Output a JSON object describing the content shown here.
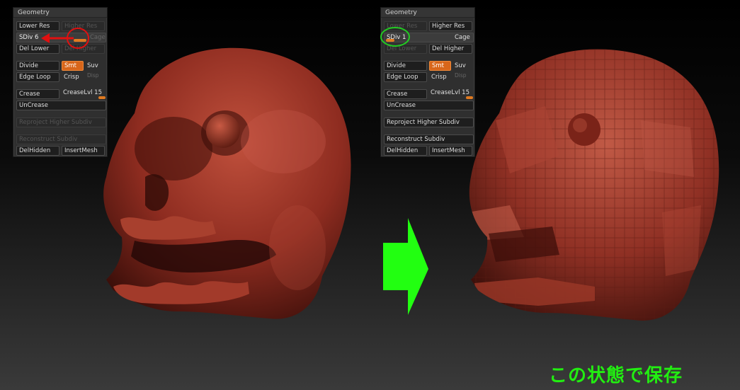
{
  "panels": [
    {
      "title": "Geometry",
      "lower_res": "Lower Res",
      "higher_res": "Higher Res",
      "sdiv": "SDiv 6",
      "cage": "Cage",
      "del_lower": "Del Lower",
      "del_higher": "Del Higher",
      "divide": "Divide",
      "smt": "Smt",
      "suv": "Suv",
      "edge_loop": "Edge Loop",
      "crisp": "Crisp",
      "disp": "Disp",
      "crease": "Crease",
      "crease_lvl": "CreaseLvl 15",
      "uncrease": "UnCrease",
      "reproject": "Reproject Higher Subdiv",
      "reconstruct": "Reconstruct Subdiv",
      "del_hidden": "DelHidden",
      "insert_mesh": "InsertMesh",
      "sdiv_level": 6
    },
    {
      "title": "Geometry",
      "lower_res": "Lower Res",
      "higher_res": "Higher Res",
      "sdiv": "SDiv 1",
      "cage": "Cage",
      "del_lower": "Del Lower",
      "del_higher": "Del Higher",
      "divide": "Divide",
      "smt": "Smt",
      "suv": "Suv",
      "edge_loop": "Edge Loop",
      "crisp": "Crisp",
      "disp": "Disp",
      "crease": "Crease",
      "crease_lvl": "CreaseLvl 15",
      "uncrease": "UnCrease",
      "reproject": "Reproject Higher Subdiv",
      "reconstruct": "Reconstruct Subdiv",
      "del_hidden": "DelHidden",
      "insert_mesh": "InsertMesh",
      "sdiv_level": 1
    }
  ],
  "caption": "この状態で保存",
  "colors": {
    "skull": "#9a3226",
    "skull_dark": "#4a130d",
    "accent_orange": "#d8661a",
    "arrow_green": "#22ff11",
    "annotation_red": "#e01010",
    "annotation_green": "#22cc22"
  }
}
